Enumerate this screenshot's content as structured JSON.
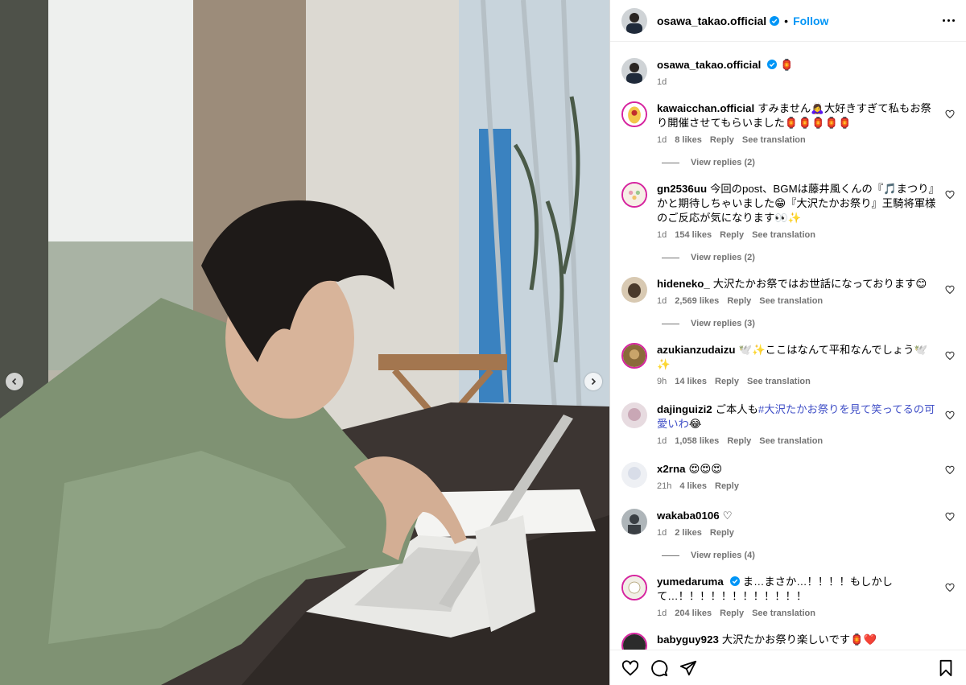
{
  "header": {
    "username": "osawa_takao.official",
    "separator": "•",
    "follow_label": "Follow"
  },
  "caption": {
    "username": "osawa_takao.official",
    "emoji": "🏮",
    "time": "1d"
  },
  "comments": [
    {
      "username": "kawaicchan.official",
      "text": "すみません🙇‍♀️大好きすぎて私もお祭り開催させてもらいました🏮🏮🏮🏮🏮",
      "time": "1d",
      "likes": "8 likes",
      "reply": "Reply",
      "see_translation": "See translation",
      "view_replies": "View replies (2)",
      "avatar_color": "#f3c64a"
    },
    {
      "username": "gn2536uu",
      "text": "今回のpost、BGMは藤井風くんの『🎵まつり』かと期待しちゃいました😁『大沢たかお祭り』王騎将軍様のご反応が気になります👀✨",
      "time": "1d",
      "likes": "154 likes",
      "reply": "Reply",
      "see_translation": "See translation",
      "view_replies": "View replies (2)",
      "avatar_color": "#f6efe6"
    },
    {
      "username": "hideneko_",
      "text": "大沢たかお祭ではお世話になっております😊",
      "time": "1d",
      "likes": "2,569 likes",
      "reply": "Reply",
      "see_translation": "See translation",
      "view_replies": "View replies (3)",
      "avatar_color": "#4a3a2c"
    },
    {
      "username": "azukianzudaizu",
      "text": "🕊️✨ここはなんて平和なんでしょう🕊️✨",
      "time": "9h",
      "likes": "14 likes",
      "reply": "Reply",
      "see_translation": "See translation",
      "avatar_color": "#8a6a3a"
    },
    {
      "username": "dajinguizi2",
      "text_before": "ご本人も",
      "tag": "#大沢たかお祭りを見て笑ってるの可愛いわ",
      "text_after": "😂",
      "time": "1d",
      "likes": "1,058 likes",
      "reply": "Reply",
      "see_translation": "See translation",
      "avatar_color": "#c9a7b5"
    },
    {
      "username": "x2rna",
      "text": "😍😍😍",
      "time": "21h",
      "likes": "4 likes",
      "reply": "Reply",
      "avatar_color": "#d8dde8"
    },
    {
      "username": "wakaba0106",
      "text": "♡",
      "time": "1d",
      "likes": "2 likes",
      "reply": "Reply",
      "view_replies": "View replies (4)",
      "avatar_color": "#3a3f44"
    },
    {
      "username": "yumedaruma",
      "text": "ま…まさか…！！！！もしかして…！！！！！！！！！！！！",
      "time": "1d",
      "likes": "204 likes",
      "reply": "Reply",
      "see_translation": "See translation",
      "avatar_color": "#f1eee6"
    },
    {
      "username": "babyguy923",
      "text": "大沢たかお祭り楽しいです🏮❤️",
      "avatar_color": "#2b2b2b"
    }
  ],
  "colors": {
    "link": "#0095f6",
    "muted": "#737373",
    "hashtag": "#4150c7",
    "verified": "#0095f6"
  },
  "icons": [
    "heart-icon",
    "comment-icon",
    "share-icon",
    "save-icon",
    "more-icon",
    "chevron-left-icon",
    "chevron-right-icon",
    "verified-icon"
  ]
}
